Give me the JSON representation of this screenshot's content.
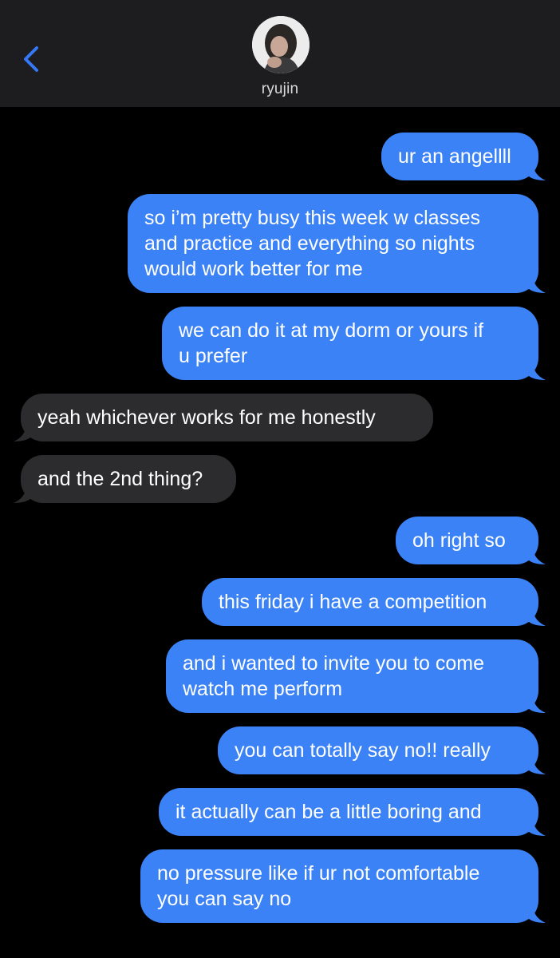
{
  "header": {
    "contact_name": "ryujin"
  },
  "colors": {
    "sent_bubble": "#3b82f6",
    "received_bubble": "#2c2c2e",
    "header_bg": "#1d1d1f",
    "accent": "#3478f6"
  },
  "icons": {
    "back": "chevron-left-icon"
  },
  "messages": [
    {
      "direction": "sent",
      "text": "ur an angellll"
    },
    {
      "direction": "sent",
      "text": "so i’m pretty busy this week w classes\nand practice and everything so nights\nwould work better for me"
    },
    {
      "direction": "sent",
      "text": "we can do it at my dorm or yours if\nu prefer"
    },
    {
      "direction": "received",
      "text": "yeah whichever works for me honestly"
    },
    {
      "direction": "received",
      "text": "and the 2nd thing?"
    },
    {
      "direction": "sent",
      "text": "oh right so"
    },
    {
      "direction": "sent",
      "text": "this friday i have a competition"
    },
    {
      "direction": "sent",
      "text": "and i wanted to invite you to come\nwatch me perform"
    },
    {
      "direction": "sent",
      "text": "you can totally say no!! really"
    },
    {
      "direction": "sent",
      "text": "it actually can be a little boring and"
    },
    {
      "direction": "sent",
      "text": "no pressure like if ur not comfortable\nyou can say no"
    }
  ]
}
